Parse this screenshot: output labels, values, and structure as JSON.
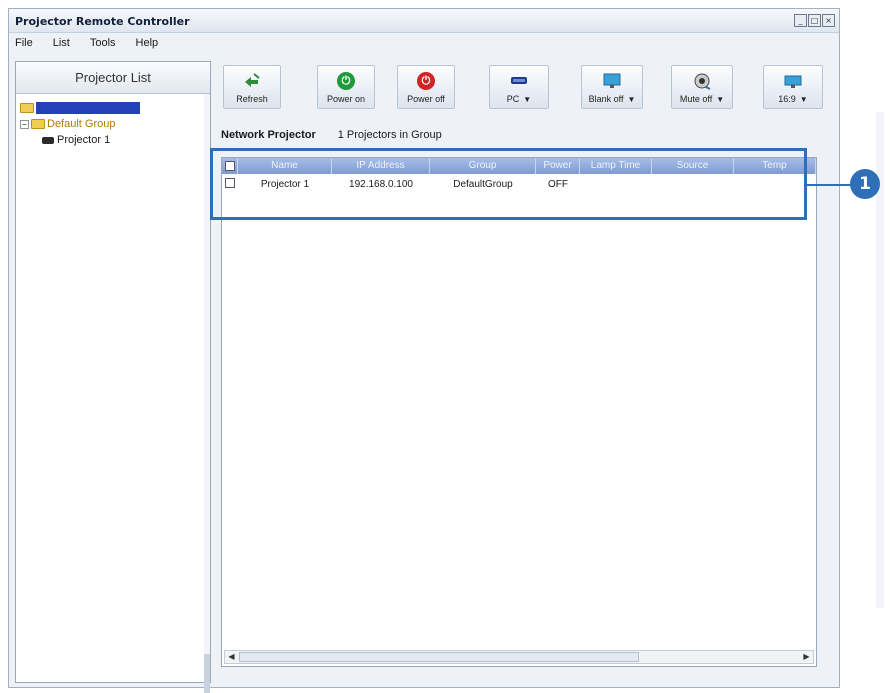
{
  "window": {
    "title": "Projector Remote Controller",
    "controls": [
      "_",
      "□",
      "×"
    ]
  },
  "menu": [
    "File",
    "List",
    "Tools",
    "Help"
  ],
  "sidebar": {
    "title": "Projector List",
    "group": "Default Group",
    "projector": "Projector 1"
  },
  "toolbar": {
    "refresh": "Refresh",
    "power_on": "Power on",
    "power_off": "Power off",
    "source": "PC",
    "blank": "Blank off",
    "mute": "Mute off",
    "aspect": "16:9"
  },
  "info": {
    "label": "Network Projector",
    "count": "1 Projectors in Group"
  },
  "table": {
    "columns": [
      "",
      "Name",
      "IP Address",
      "Group",
      "Power",
      "Lamp Time",
      "Source",
      "Temp"
    ],
    "rows": [
      {
        "name": "Projector 1",
        "ip": "192.168.0.100",
        "group": "DefaultGroup",
        "power": "OFF",
        "lamp": "",
        "source": "",
        "temp": ""
      }
    ]
  },
  "callout": "1",
  "colors": {
    "accent": "#2f6fb8",
    "header": "#8ea9da",
    "power_on": "#1f9a3a",
    "power_off": "#d02525",
    "selection": "#2340b8"
  },
  "icons": [
    "refresh-icon",
    "power-on-icon",
    "power-off-icon",
    "source-icon",
    "blank-icon",
    "mute-icon",
    "aspect-icon",
    "folder-icon",
    "projector-icon"
  ]
}
